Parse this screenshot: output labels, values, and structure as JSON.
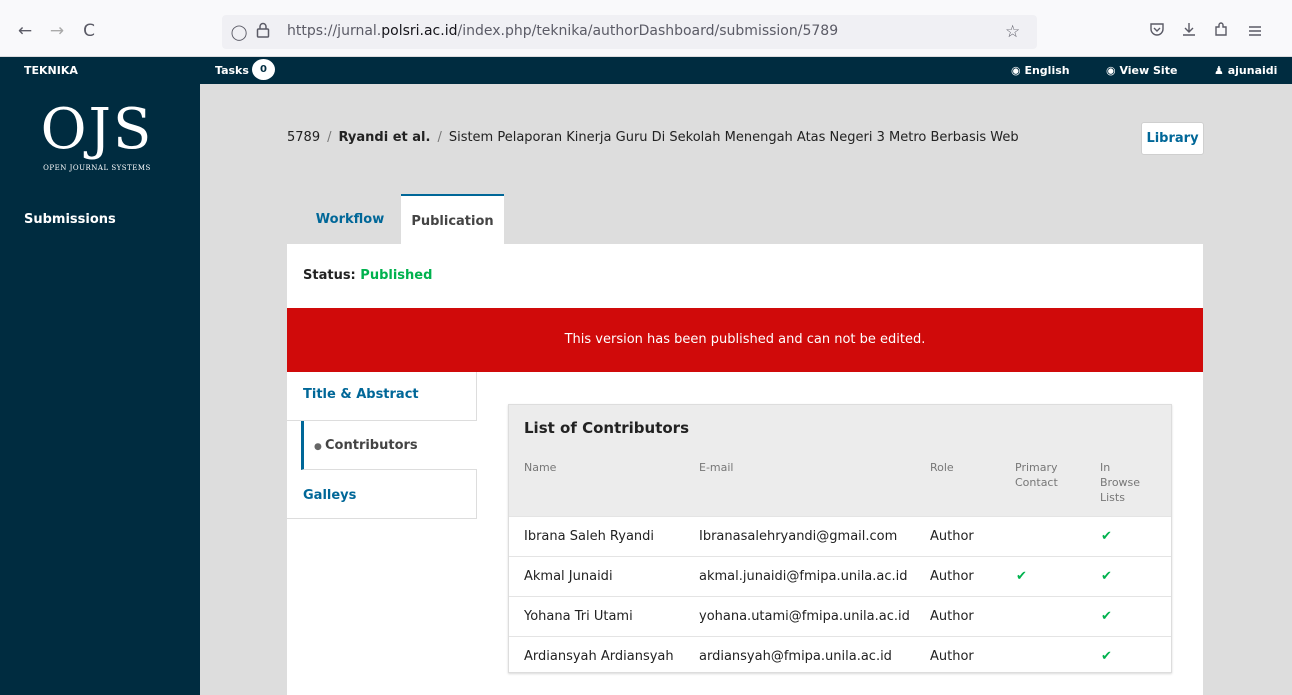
{
  "browser": {
    "back_icon": "←",
    "forward_icon": "→",
    "reload_icon": "C",
    "url_prefix": "https://jurnal.",
    "url_domain": "polsri.ac.id",
    "url_path": "/index.php/teknika/authorDashboard/submission/5789"
  },
  "topbar": {
    "site_name": "TEKNIKA",
    "tasks_label": "Tasks",
    "tasks_count": "0",
    "language": "English",
    "view_site": "View Site",
    "user": "ajunaidi"
  },
  "sidebar": {
    "logo_main": "OJS",
    "logo_sub": "OPEN JOURNAL SYSTEMS",
    "items": [
      {
        "label": "Submissions"
      }
    ]
  },
  "breadcrumb": {
    "id": "5789",
    "authors": "Ryandi et al.",
    "title": "Sistem Pelaporan Kinerja Guru Di Sekolah Menengah Atas Negeri 3 Metro Berbasis Web"
  },
  "library_label": "Library",
  "tabs": [
    {
      "label": "Workflow"
    },
    {
      "label": "Publication"
    }
  ],
  "status": {
    "label": "Status:",
    "value": "Published"
  },
  "notice": "This version has been published and can not be edited.",
  "sub_tabs": [
    {
      "label": "Title & Abstract"
    },
    {
      "label": "Contributors"
    },
    {
      "label": "Galleys"
    }
  ],
  "contributors": {
    "title": "List of Contributors",
    "headers": {
      "name": "Name",
      "email": "E-mail",
      "role": "Role",
      "primary": "Primary Contact",
      "browse": "In Browse Lists"
    },
    "rows": [
      {
        "name": "Ibrana Saleh Ryandi",
        "email": "Ibranasalehryandi@gmail.com",
        "role": "Author",
        "primary": false,
        "browse": true
      },
      {
        "name": "Akmal Junaidi",
        "email": "akmal.junaidi@fmipa.unila.ac.id",
        "role": "Author",
        "primary": true,
        "browse": true
      },
      {
        "name": "Yohana Tri Utami",
        "email": "yohana.utami@fmipa.unila.ac.id",
        "role": "Author",
        "primary": false,
        "browse": true
      },
      {
        "name": "Ardiansyah Ardiansyah",
        "email": "ardiansyah@fmipa.unila.ac.id",
        "role": "Author",
        "primary": false,
        "browse": true
      }
    ]
  },
  "colors": {
    "brand": "#002c40",
    "link": "#006798",
    "success": "#00b24e",
    "danger": "#d00a0a"
  }
}
